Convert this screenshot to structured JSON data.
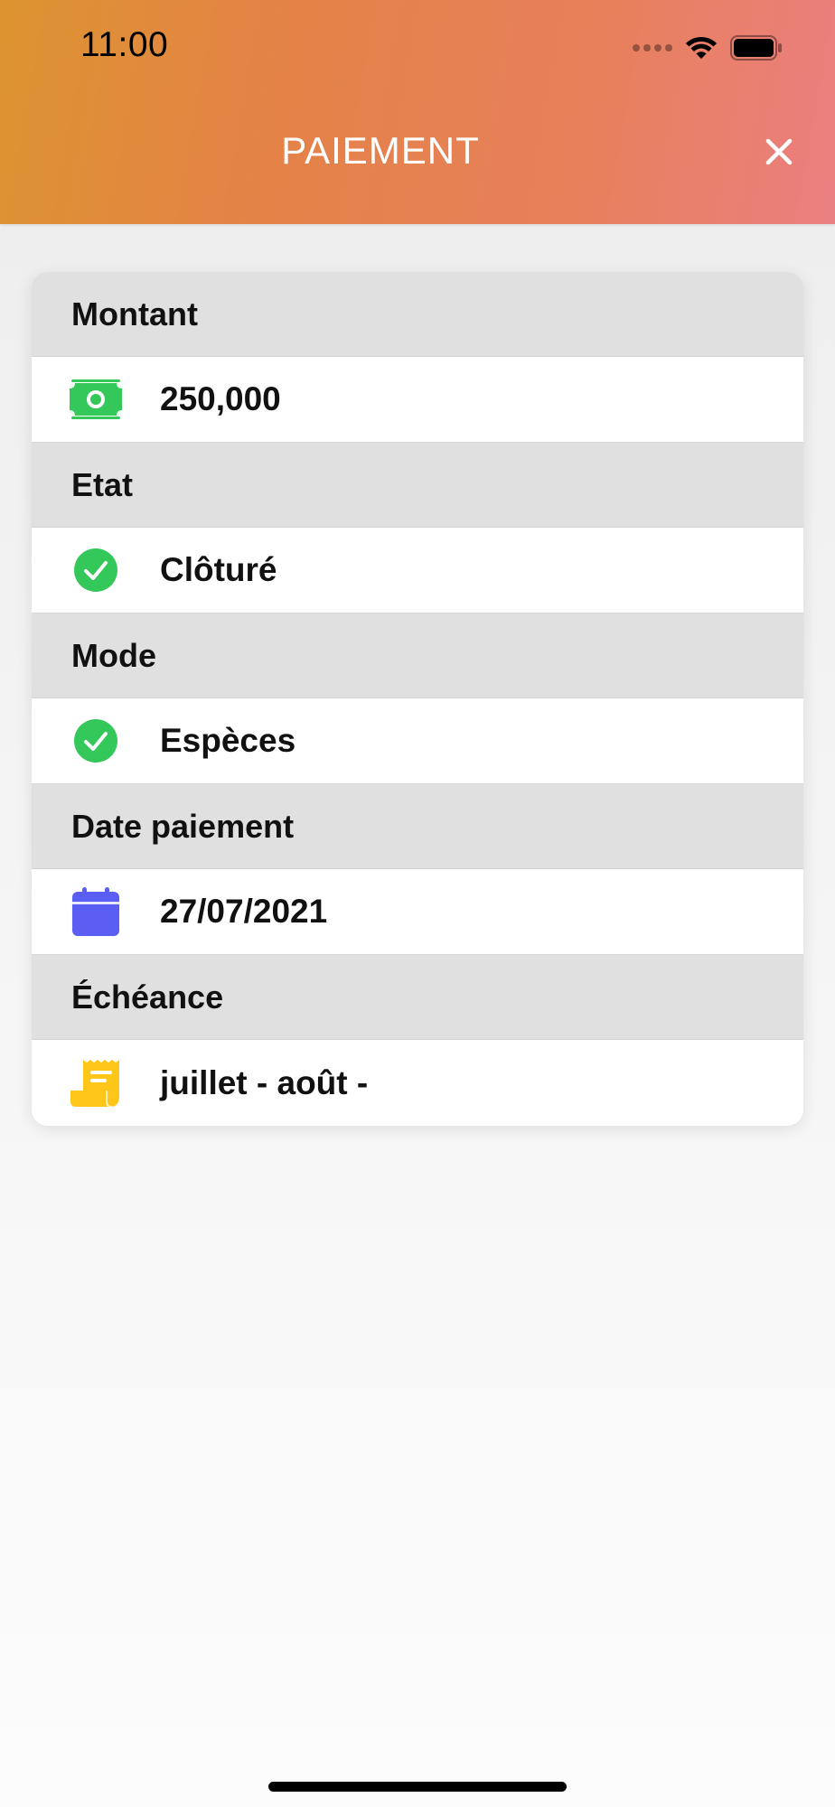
{
  "status_bar": {
    "time": "11:00"
  },
  "nav": {
    "title": "PAIEMENT"
  },
  "sections": [
    {
      "label": "Montant",
      "value": "250,000",
      "icon": "money-icon",
      "icon_color": "#34c759"
    },
    {
      "label": "Etat",
      "value": "Clôturé",
      "icon": "check-circle-icon",
      "icon_color": "#34c759"
    },
    {
      "label": "Mode",
      "value": "Espèces",
      "icon": "check-circle-icon",
      "icon_color": "#34c759"
    },
    {
      "label": "Date paiement",
      "value": "27/07/2021",
      "icon": "calendar-icon",
      "icon_color": "#5b5ef2"
    },
    {
      "label": "Échéance",
      "value": "juillet - août -",
      "icon": "receipt-icon",
      "icon_color": "#ffc61a"
    }
  ],
  "colors": {
    "header_gradient_start": "#dd9430",
    "header_gradient_end": "#ea7f80",
    "section_header_bg": "#e0e0e0"
  }
}
